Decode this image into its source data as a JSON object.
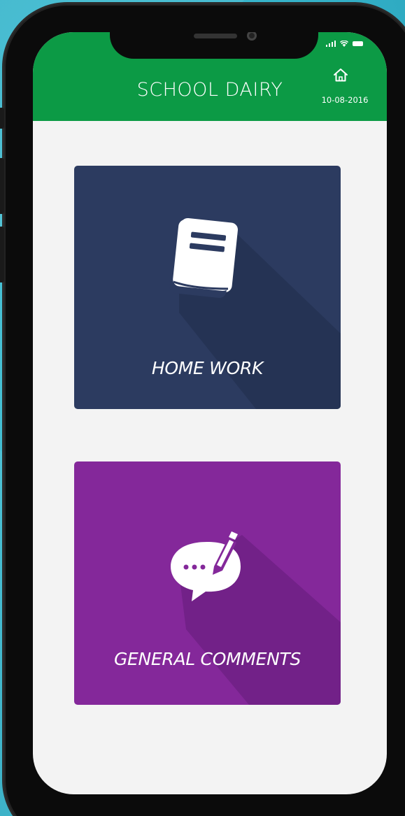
{
  "app": {
    "title": "SCHOOL DAIRY",
    "date": "10-08-2016",
    "home_icon": "home-icon"
  },
  "status_bar": {
    "signal_icon": "signal-icon",
    "wifi_icon": "wifi-icon",
    "battery_icon": "battery-icon"
  },
  "menu": {
    "items": [
      {
        "label": "HOME WORK",
        "icon": "book-icon",
        "color": "#2c3b60"
      },
      {
        "label": "GENERAL COMMENTS",
        "icon": "comment-edit-icon",
        "color": "#84289a"
      }
    ]
  },
  "colors": {
    "header": "#0c9a45",
    "screen_bg": "#f3f3f3",
    "background": "#3bb9cf"
  }
}
